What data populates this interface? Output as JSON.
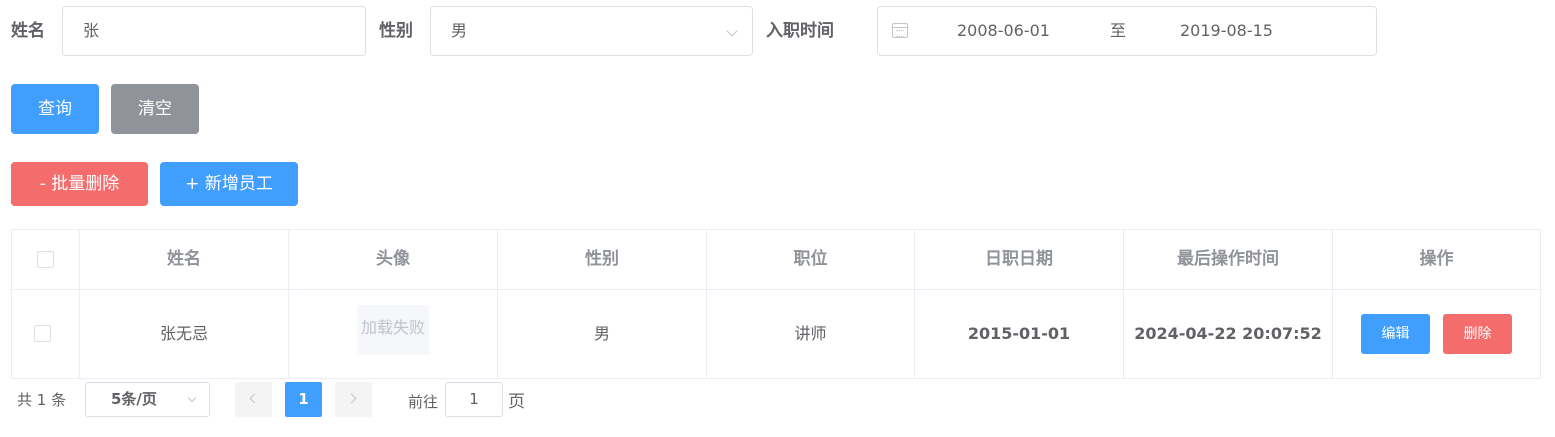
{
  "search": {
    "name_label": "姓名",
    "name_value": "张",
    "gender_label": "性别",
    "gender_value": "男",
    "date_label": "入职时间",
    "date_start": "2008-06-01",
    "date_separator": "至",
    "date_end": "2019-08-15"
  },
  "buttons": {
    "query": "查询",
    "clear": "清空",
    "batch_delete": "- 批量删除",
    "add_employee": "+ 新增员工"
  },
  "table": {
    "headers": [
      "姓名",
      "头像",
      "性别",
      "职位",
      "日职日期",
      "最后操作时间",
      "操作"
    ],
    "rows": [
      {
        "name": "张无忌",
        "avatar_status": "加载失败",
        "gender": "男",
        "position": "讲师",
        "entry_date": "2015-01-01",
        "last_operate_time": "2024-04-22 20:07:52",
        "edit_label": "编辑",
        "delete_label": "删除"
      }
    ]
  },
  "pagination": {
    "total": "共 1 条",
    "page_size": "5条/页",
    "current_page": "1",
    "goto_prefix": "前往",
    "goto_value": "1",
    "goto_suffix": "页"
  },
  "colors": {
    "primary": "#409eff",
    "danger": "#f56c6c",
    "info": "#909399"
  }
}
